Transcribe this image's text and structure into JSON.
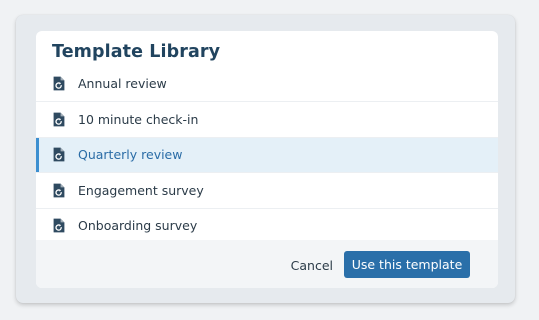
{
  "dialog": {
    "title": "Template Library",
    "templates": [
      {
        "label": "Annual review",
        "icon": "document-refresh-icon",
        "selected": false
      },
      {
        "label": "10 minute check-in",
        "icon": "document-refresh-icon",
        "selected": false
      },
      {
        "label": "Quarterly review",
        "icon": "document-refresh-icon",
        "selected": true
      },
      {
        "label": "Engagement survey",
        "icon": "document-refresh-icon",
        "selected": false
      },
      {
        "label": "Onboarding survey",
        "icon": "document-refresh-icon",
        "selected": false
      }
    ],
    "cancel_label": "Cancel",
    "use_label": "Use this template"
  },
  "colors": {
    "title": "#21445f",
    "icon": "#2f4a60",
    "selected_background": "#e4f0f8",
    "selected_accent": "#3d8fd0",
    "selected_text": "#2a6ca6",
    "primary_button": "#2a6fa9"
  }
}
